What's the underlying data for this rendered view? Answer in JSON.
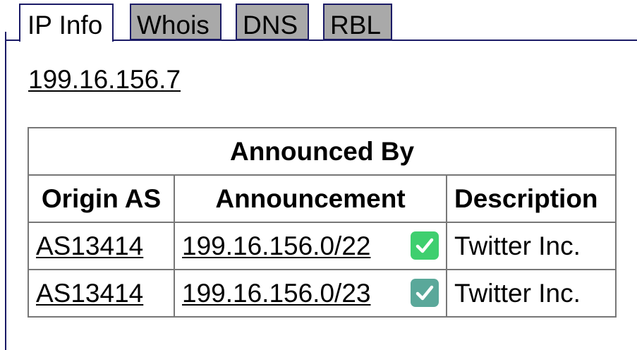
{
  "tabs": [
    {
      "label": "IP Info",
      "active": true
    },
    {
      "label": "Whois",
      "active": false
    },
    {
      "label": "DNS",
      "active": false
    },
    {
      "label": "RBL",
      "active": false
    }
  ],
  "ip": "199.16.156.7",
  "table": {
    "caption": "Announced By",
    "headers": [
      "Origin AS",
      "Announcement",
      "Description"
    ],
    "rows": [
      {
        "origin_as": "AS13414",
        "announcement": "199.16.156.0/22",
        "status_icon": "check-icon",
        "status_color": "#3fcf6f",
        "description": "Twitter Inc."
      },
      {
        "origin_as": "AS13414",
        "announcement": "199.16.156.0/23",
        "status_icon": "check-icon",
        "status_color": "#5aa89a",
        "description": "Twitter Inc."
      }
    ]
  },
  "colors": {
    "tab_border": "#1a1a66",
    "inactive_tab_bg": "#a9a9a9",
    "table_border": "#777777"
  }
}
